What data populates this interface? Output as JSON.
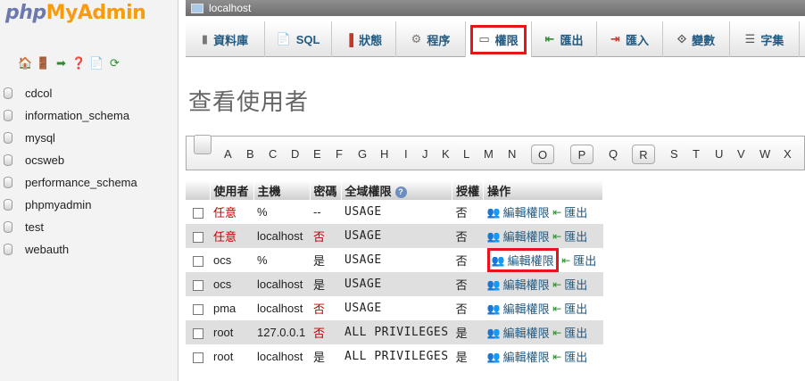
{
  "logo": {
    "php": "php",
    "myadmin": "MyAdmin"
  },
  "databases": [
    "cdcol",
    "information_schema",
    "mysql",
    "ocsweb",
    "performance_schema",
    "phpmyadmin",
    "test",
    "webauth"
  ],
  "server": {
    "title": "localhost"
  },
  "tabs": [
    {
      "label": "資料庫",
      "icon": "database-icon"
    },
    {
      "label": "SQL",
      "icon": "sql-icon"
    },
    {
      "label": "狀態",
      "icon": "status-icon"
    },
    {
      "label": "程序",
      "icon": "process-icon"
    },
    {
      "label": "權限",
      "icon": "privileges-icon"
    },
    {
      "label": "匯出",
      "icon": "export-icon"
    },
    {
      "label": "匯入",
      "icon": "import-icon"
    },
    {
      "label": "變數",
      "icon": "variables-icon"
    },
    {
      "label": "字集",
      "icon": "charset-icon"
    }
  ],
  "page": {
    "title": "查看使用者"
  },
  "alphabet": [
    "A",
    "B",
    "C",
    "D",
    "E",
    "F",
    "G",
    "H",
    "I",
    "J",
    "K",
    "L",
    "M",
    "N",
    "O",
    "P",
    "Q",
    "R",
    "S",
    "T",
    "U",
    "V",
    "W",
    "X"
  ],
  "alphabet_highlighted": [
    "O",
    "P",
    "R"
  ],
  "table": {
    "headers": {
      "user": "使用者",
      "host": "主機",
      "password": "密碼",
      "global_privileges": "全域權限",
      "grant": "授權",
      "action": "操作"
    },
    "edit_label": "編輯權限",
    "export_label": "匯出",
    "rows": [
      {
        "user": "任意",
        "user_red": true,
        "host": "%",
        "password": "--",
        "password_red": false,
        "privileges": "USAGE",
        "grant": "否"
      },
      {
        "user": "任意",
        "user_red": true,
        "host": "localhost",
        "password": "否",
        "password_red": true,
        "privileges": "USAGE",
        "grant": "否"
      },
      {
        "user": "ocs",
        "user_red": false,
        "host": "%",
        "password": "是",
        "password_red": false,
        "privileges": "USAGE",
        "grant": "否"
      },
      {
        "user": "ocs",
        "user_red": false,
        "host": "localhost",
        "password": "是",
        "password_red": false,
        "privileges": "USAGE",
        "grant": "否"
      },
      {
        "user": "pma",
        "user_red": false,
        "host": "localhost",
        "password": "否",
        "password_red": true,
        "privileges": "USAGE",
        "grant": "否"
      },
      {
        "user": "root",
        "user_red": false,
        "host": "127.0.0.1",
        "password": "否",
        "password_red": true,
        "privileges": "ALL PRIVILEGES",
        "grant": "是"
      },
      {
        "user": "root",
        "user_red": false,
        "host": "localhost",
        "password": "是",
        "password_red": false,
        "privileges": "ALL PRIVILEGES",
        "grant": "是"
      }
    ]
  },
  "colors": {
    "link": "#235a81",
    "highlight": "#e8141c",
    "warning_text": "#c00000",
    "logo_php": "#6c78af",
    "logo_myadmin": "#f89c0e"
  }
}
